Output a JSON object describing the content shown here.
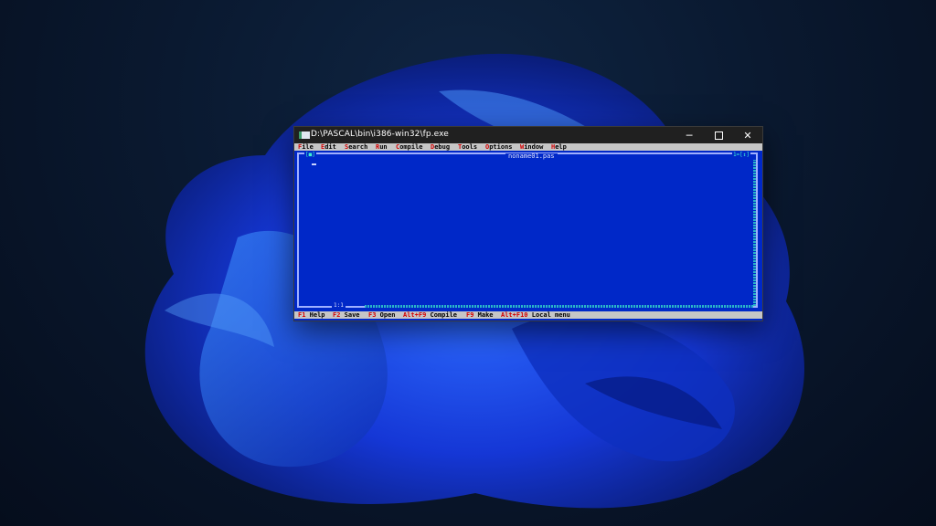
{
  "window": {
    "title": "D:\\PASCAL\\bin\\i386-win32\\fp.exe",
    "min_glyph": "─",
    "close_glyph": "✕"
  },
  "menu": [
    {
      "hot": "F",
      "rest": "ile"
    },
    {
      "hot": "E",
      "rest": "dit"
    },
    {
      "hot": "S",
      "rest": "earch"
    },
    {
      "hot": "R",
      "rest": "un"
    },
    {
      "hot": "C",
      "rest": "ompile"
    },
    {
      "hot": "D",
      "rest": "ebug"
    },
    {
      "hot": "T",
      "rest": "ools"
    },
    {
      "hot": "O",
      "rest": "ptions"
    },
    {
      "hot": "W",
      "rest": "indow"
    },
    {
      "hot": "H",
      "rest": "elp"
    }
  ],
  "editor": {
    "file_name": "noname01.pas",
    "close_mark": "[■]",
    "window_number": "1=[↕]",
    "cursor_pos": "1:1"
  },
  "status": [
    {
      "key": "F1",
      "label": "Help"
    },
    {
      "key": "F2",
      "label": "Save"
    },
    {
      "key": "F3",
      "label": "Open"
    },
    {
      "key": "Alt+F9",
      "label": "Compile"
    },
    {
      "key": "F9",
      "label": "Make"
    },
    {
      "key": "Alt+F10",
      "label": "Local menu"
    }
  ],
  "colors": {
    "editor_bg": "#0028c8",
    "menu_bg": "#c6c6c6",
    "hotkey": "#d40000",
    "titlebar": "#202020"
  }
}
